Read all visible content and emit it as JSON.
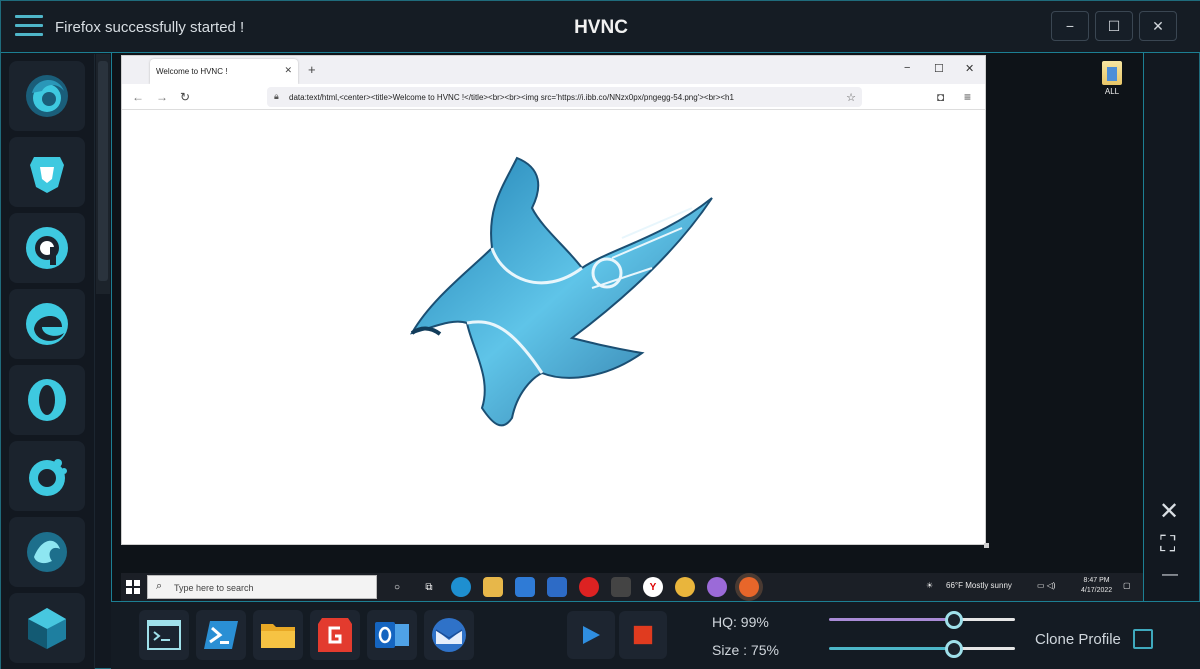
{
  "window": {
    "status_text": "Firefox successfully started !",
    "title": "HVNC",
    "controls": {
      "minimize": "−",
      "maximize": "☐",
      "close": "✕"
    }
  },
  "sidebar": {
    "items": [
      {
        "name": "firefox-icon"
      },
      {
        "name": "brave-icon"
      },
      {
        "name": "chromium-icon"
      },
      {
        "name": "edge-icon"
      },
      {
        "name": "opera-icon"
      },
      {
        "name": "opera-gx-icon"
      },
      {
        "name": "waterfox-icon"
      },
      {
        "name": "cube-icon"
      }
    ]
  },
  "remote": {
    "desktop_icon_label": "ALL",
    "browser": {
      "tab_title": "Welcome to HVNC !",
      "tab_close": "✕",
      "new_tab": "+",
      "url": "data:text/html,<center><title>Welcome to HVNC !</title><br><br><img src='https://i.ibb.co/NNzx0px/pngegg-54.png'><br><h1",
      "controls": {
        "minimize": "−",
        "maximize": "☐",
        "close": "✕"
      }
    },
    "taskbar": {
      "search_placeholder": "Type here to search",
      "weather": "66°F  Mostly sunny",
      "time": "8:47 PM",
      "date": "4/17/2022"
    }
  },
  "right_controls": {
    "close": "✕",
    "fullscreen": "⛶",
    "minimize": "—"
  },
  "bottom": {
    "quick_apps": [
      {
        "name": "cmd-icon"
      },
      {
        "name": "powershell-icon"
      },
      {
        "name": "folder-icon"
      },
      {
        "name": "foxit-icon"
      },
      {
        "name": "outlook-icon"
      },
      {
        "name": "thunderbird-icon"
      }
    ],
    "hq_label": "HQ: 99%",
    "size_label": "Size : 75%",
    "hq_value": 0.99,
    "size_value": 0.75,
    "clone_profile_label": "Clone Profile",
    "clone_profile_checked": false
  },
  "colors": {
    "accent": "#1c7f93",
    "slider_hq": "#a98bd6",
    "slider_size": "#4db7c8",
    "stop": "#e03b1f",
    "play": "#2f8ee0"
  }
}
